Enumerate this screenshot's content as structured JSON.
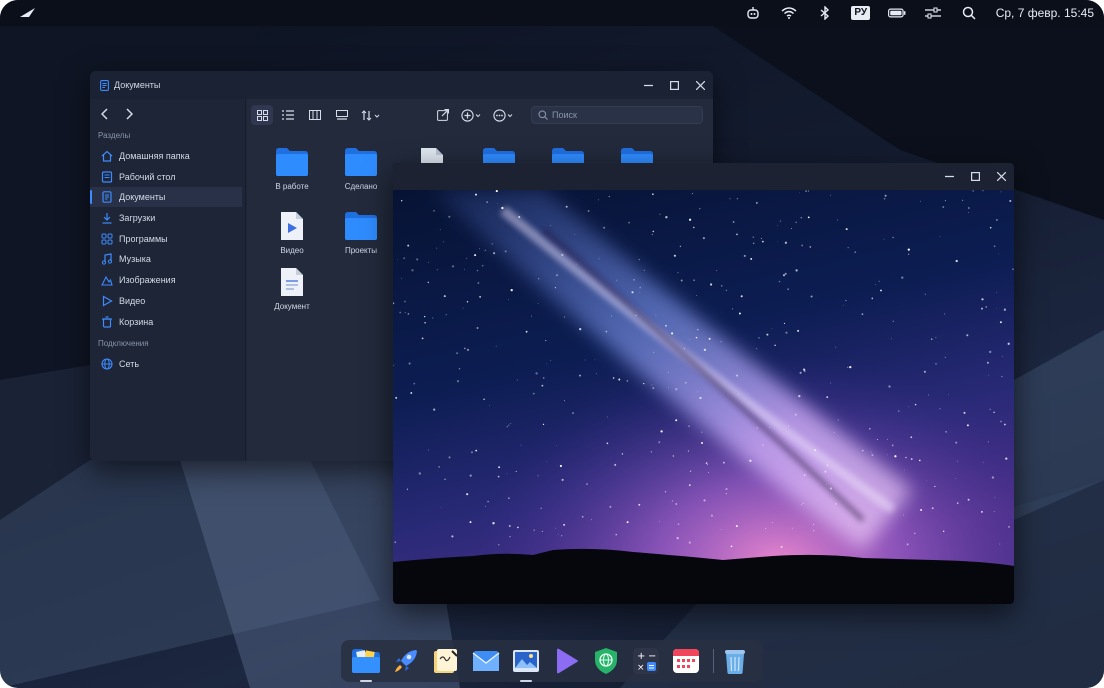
{
  "topbar": {
    "lang": "РУ",
    "clock": "Ср, 7 февр. 15:45",
    "tray_icons": [
      "assistant-icon",
      "wifi-icon",
      "bluetooth-icon",
      "keyboard-layout-icon",
      "battery-icon",
      "sliders-icon",
      "search-icon"
    ]
  },
  "file_manager": {
    "title": "Документы",
    "sidebar": {
      "section_places": "Разделы",
      "items": [
        {
          "label": "Домашняя папка",
          "icon": "home-icon"
        },
        {
          "label": "Рабочий стол",
          "icon": "desktop-icon"
        },
        {
          "label": "Документы",
          "icon": "document-icon",
          "active": true
        },
        {
          "label": "Загрузки",
          "icon": "download-icon"
        },
        {
          "label": "Программы",
          "icon": "apps-icon"
        },
        {
          "label": "Музыка",
          "icon": "music-icon"
        },
        {
          "label": "Изображения",
          "icon": "image-icon"
        },
        {
          "label": "Видео",
          "icon": "video-icon"
        },
        {
          "label": "Корзина",
          "icon": "trash-icon"
        }
      ],
      "section_connections": "Подключения",
      "network": {
        "label": "Сеть",
        "icon": "network-icon"
      }
    },
    "search_placeholder": "Поиск",
    "files": [
      {
        "name": "В работе",
        "type": "folder"
      },
      {
        "name": "Сделано",
        "type": "folder"
      },
      {
        "name": "Видео",
        "type": "video"
      },
      {
        "name": "Проекты",
        "type": "folder"
      },
      {
        "name": "Документ",
        "type": "document"
      }
    ]
  },
  "dock": {
    "apps": [
      "file-manager-icon",
      "launcher-rocket-icon",
      "notes-icon",
      "mail-icon",
      "image-viewer-icon",
      "media-player-icon",
      "vpn-shield-icon",
      "calculator-icon",
      "calendar-icon",
      "trash-bin-icon"
    ]
  },
  "colors": {
    "accent": "#3d8cff",
    "folder": "#2f8cff",
    "panel": "#0a0f1a"
  }
}
